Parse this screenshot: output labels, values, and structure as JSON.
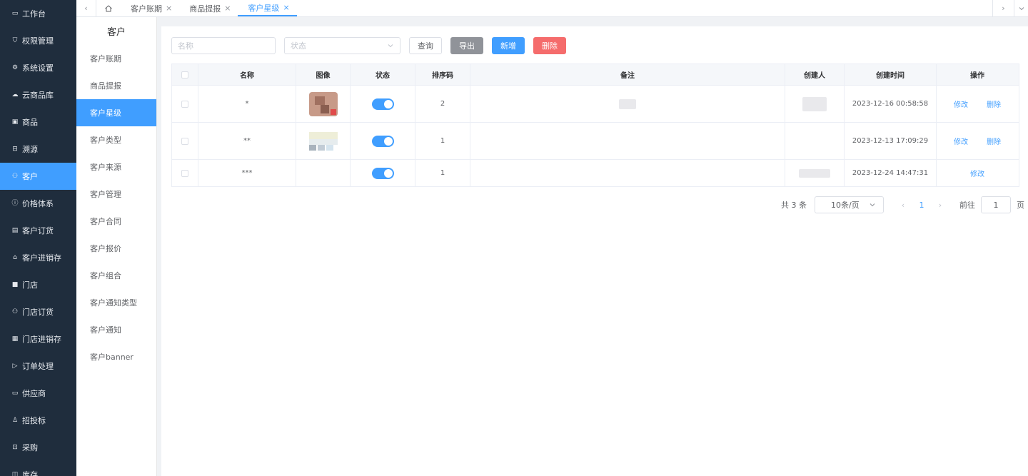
{
  "sidebar": {
    "items": [
      {
        "label": "工作台",
        "icon": "monitor-icon"
      },
      {
        "label": "权限管理",
        "icon": "shield-icon"
      },
      {
        "label": "系统设置",
        "icon": "gear-icon"
      },
      {
        "label": "云商品库",
        "icon": "cloud-icon"
      },
      {
        "label": "商品",
        "icon": "goods-icon"
      },
      {
        "label": "溯源",
        "icon": "trace-icon"
      },
      {
        "label": "客户",
        "icon": "customer-icon"
      },
      {
        "label": "价格体系",
        "icon": "price-icon"
      },
      {
        "label": "客户订货",
        "icon": "order-icon"
      },
      {
        "label": "客户进销存",
        "icon": "bank-icon"
      },
      {
        "label": "门店",
        "icon": "store-icon"
      },
      {
        "label": "门店订货",
        "icon": "store-order-icon"
      },
      {
        "label": "门店进销存",
        "icon": "warehouse-icon"
      },
      {
        "label": "订单处理",
        "icon": "send-icon"
      },
      {
        "label": "供应商",
        "icon": "supplier-icon"
      },
      {
        "label": "招投标",
        "icon": "user-icon"
      },
      {
        "label": "采购",
        "icon": "purchase-icon"
      },
      {
        "label": "库存",
        "icon": "inventory-icon"
      }
    ],
    "active_index": 6
  },
  "tabs": {
    "items": [
      {
        "label": "客户账期"
      },
      {
        "label": "商品提报"
      },
      {
        "label": "客户星级"
      }
    ],
    "active_index": 2,
    "close_glyph": "×"
  },
  "submenu": {
    "title": "客户",
    "items": [
      "客户账期",
      "商品提报",
      "客户星级",
      "客户类型",
      "客户来源",
      "客户管理",
      "客户合同",
      "客户报价",
      "客户组合",
      "客户通知类型",
      "客户通知",
      "客户banner"
    ],
    "active_index": 2
  },
  "toolbar": {
    "name_placeholder": "名称",
    "status_placeholder": "状态",
    "query_label": "查询",
    "export_label": "导出",
    "add_label": "新增",
    "delete_label": "删除"
  },
  "table": {
    "headers": [
      "名称",
      "图像",
      "状态",
      "排序码",
      "备注",
      "创建人",
      "创建时间",
      "操作"
    ],
    "rows": [
      {
        "name": "*",
        "sort": "2",
        "time": "2023-12-16 00:58:58",
        "status_on": true,
        "ops": [
          "修改",
          "删除"
        ]
      },
      {
        "name": "**",
        "sort": "1",
        "time": "2023-12-13 17:09:29",
        "status_on": true,
        "ops": [
          "修改",
          "删除"
        ]
      },
      {
        "name": "***",
        "sort": "1",
        "time": "2023-12-24 14:47:31",
        "status_on": true,
        "ops": [
          "修改"
        ]
      }
    ]
  },
  "pagination": {
    "total_text": "共 3 条",
    "page_size": "10条/页",
    "current_page": "1",
    "goto_label": "前往",
    "goto_value": "1",
    "unit_label": "页"
  },
  "colors": {
    "primary": "#409eff",
    "danger": "#f56c6c",
    "info": "#909399",
    "sidebar_bg": "#1f2d3d"
  }
}
